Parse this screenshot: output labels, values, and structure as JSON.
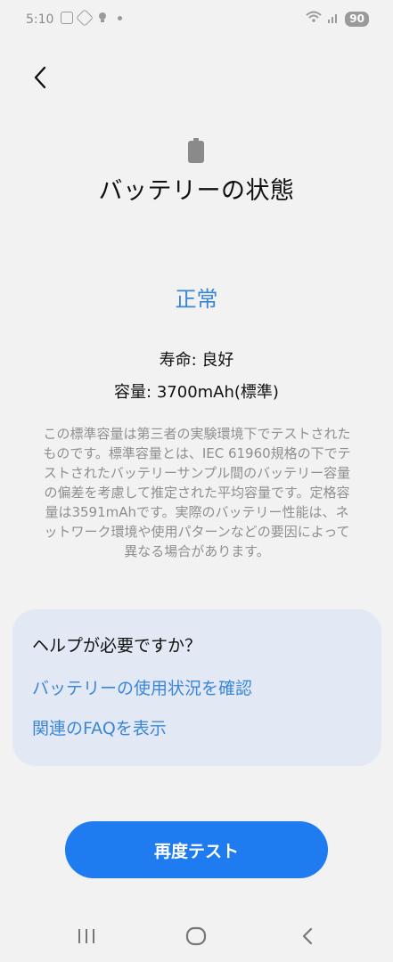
{
  "status_bar": {
    "time": "5:10",
    "battery_level": "90"
  },
  "page": {
    "title": "バッテリーの状態",
    "status": "正常",
    "life_line": "寿命: 良好",
    "capacity_line": "容量: 3700mAh(標準)",
    "description": "この標準容量は第三者の実験環境下でテストされたものです。標準容量とは、IEC 61960規格の下でテストされたバッテリーサンプル間のバッテリー容量の偏差を考慮して推定された平均容量です。定格容量は3591mAhです。実際のバッテリー性能は、ネットワーク環境や使用パターンなどの要因によって異なる場合があります。"
  },
  "help_card": {
    "title": "ヘルプが必要ですか？",
    "links": [
      "バッテリーの使用状況を確認",
      "関連のFAQを表示"
    ]
  },
  "actions": {
    "retest_label": "再度テスト"
  },
  "colors": {
    "accent_blue": "#3c86d6",
    "button_blue": "#1e7bf0",
    "card_bg": "#e2e9f5",
    "page_bg": "#f2f2f2"
  },
  "icons": {
    "back": "chevron-left-icon",
    "battery": "battery-icon",
    "nav_recents": "recents-icon",
    "nav_home": "home-icon",
    "nav_back": "back-icon"
  }
}
